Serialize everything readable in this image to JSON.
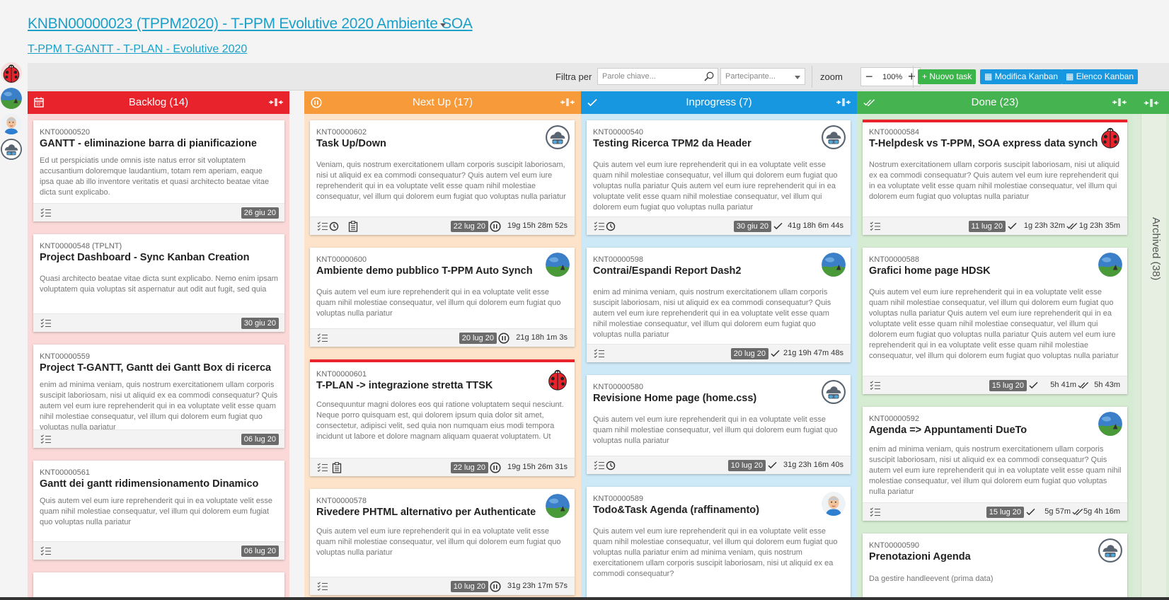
{
  "header": {
    "title": "KNBN00000023 (TPPM2020) - T-PPM Evolutive 2020 Ambiente SOA",
    "subtitle": "T-PPM T-GANTT - T-PLAN - Evolutive 2020"
  },
  "toolbar": {
    "filter_label": "Filtra per",
    "keyword_placeholder": "Parole chiave...",
    "participant_placeholder": "Partecipante...",
    "zoom_label": "zoom",
    "zoom_value": "100%",
    "new_task": "Nuovo task",
    "edit_kanban": "Modifica Kanban",
    "list_kanban": "Elenco Kanban"
  },
  "columns": {
    "backlog": {
      "label": "Backlog (14)",
      "color": "#e8232b",
      "cards": [
        {
          "code": "KNT00000520",
          "title": "GANTT - eliminazione barra di pianificazione",
          "desc": "Ed ut perspiciatis unde omnis iste natus error sit voluptatem accusantium doloremque laudantium, totam rem aperiam, eaque ipsa quae ab illo inventore veritatis et quasi architecto beatae vitae dicta sunt explicabo.",
          "date": "26 giu 20"
        },
        {
          "code": "KNT00000548 (TPLNT)",
          "title": "Project Dashboard - Sync Kanban Creation",
          "desc": "Quasi architecto beatae vitae dicta sunt explicabo. Nemo enim ipsam voluptatem quia voluptas sit aspernatur aut odit aut fugit, sed quia",
          "date": "30 giu 20"
        },
        {
          "code": "KNT00000559",
          "title": "Project T-GANTT, Gantt dei Gantt Box di ricerca",
          "desc": "enim ad minima veniam, quis nostrum exercitationem ullam corporis suscipit laboriosam, nisi ut aliquid ex ea commodi consequatur? Quis autem vel eum iure reprehenderit qui in ea voluptate velit esse quam nihil molestiae consequatur, vel illum qui dolorem eum fugiat quo voluptas nulla pariatur",
          "date": "06 lug 20"
        },
        {
          "code": "KNT00000561",
          "title": "Gantt dei gantt ridimensionamento Dinamico",
          "desc": "Quis autem vel eum iure reprehenderit qui in ea voluptate velit esse quam nihil molestiae consequatur, vel illum qui dolorem eum fugiat quo voluptas nulla pariatur",
          "date": "06 lug 20"
        }
      ]
    },
    "nextup": {
      "label": "Next Up (17)",
      "color": "#f79a3a",
      "cards": [
        {
          "code": "KNT00000602",
          "title": "Task Up/Down",
          "desc": "Veniam, quis nostrum exercitationem ullam corporis suscipit laboriosam, nisi ut aliquid ex ea commodi consequatur? Quis autem vel eum iure reprehenderit qui in ea voluptate velit esse quam nihil molestiae consequatur, vel illum qui dolorem eum fugiat quo voluptas nulla pariatur",
          "date": "22 lug 20",
          "metric1": "19g 15h 28m 52s"
        },
        {
          "code": "KNT00000600",
          "title": "Ambiente demo pubblico T-PPM Auto Synch",
          "desc": "Quis autem vel eum iure reprehenderit qui in ea voluptate velit esse quam nihil molestiae consequatur, vel illum qui dolorem eum fugiat quo voluptas nulla pariatur",
          "date": "20 lug 20",
          "metric1": "21g 18h 1m 3s"
        },
        {
          "code": "KNT00000601",
          "title": "T-PLAN -> integrazione stretta TTSK",
          "desc": "Consequuntur magni dolores eos qui ratione voluptatem sequi nesciunt. Neque porro quisquam est, qui dolorem ipsum quia dolor sit amet, consectetur, adipisci velit, sed quia non numquam eius modi tempora incidunt ut labore et dolore magnam aliquam quaerat voluptatem. Ut",
          "date": "22 lug 20",
          "metric1": "19g 15h 26m 31s"
        },
        {
          "code": "KNT00000578",
          "title": "Rivedere PHTML alternativo per Authenticate",
          "desc": "Quis autem vel eum iure reprehenderit qui in ea voluptate velit esse quam nihil molestiae consequatur, vel illum qui dolorem eum fugiat quo voluptas nulla pariatur",
          "date": "10 lug 20",
          "metric1": "31g 23h 17m 57s"
        }
      ]
    },
    "inprogress": {
      "label": "Inprogress (7)",
      "color": "#1797e0",
      "cards": [
        {
          "code": "KNT00000540",
          "title": "Testing Ricerca TPM2 da Header",
          "desc": "Quis autem vel eum iure reprehenderit qui in ea voluptate velit esse quam nihil molestiae consequatur, vel illum qui dolorem eum fugiat quo voluptas nulla pariatur Quis autem vel eum iure reprehenderit qui in ea voluptate velit esse quam nihil molestiae consequatur, vel illum qui dolorem eum fugiat quo voluptas nulla pariatur",
          "date": "30 giu 20",
          "metric1": "41g 18h 6m 44s"
        },
        {
          "code": "KNT00000598",
          "title": "Contrai/Espandi Report Dash2",
          "desc": "enim ad minima veniam, quis nostrum exercitationem ullam corporis suscipit laboriosam, nisi ut aliquid ex ea commodi consequatur? Quis autem vel eum iure reprehenderit qui in ea voluptate velit esse quam nihil molestiae consequatur, vel illum qui dolorem eum fugiat quo voluptas nulla pariatur",
          "date": "20 lug 20",
          "metric1": "21g 19h 47m 48s"
        },
        {
          "code": "KNT00000580",
          "title": "Revisione Home page (home.css)",
          "desc": "Quis autem vel eum iure reprehenderit qui in ea voluptate velit esse quam nihil molestiae consequatur, vel illum qui dolorem eum fugiat quo voluptas nulla pariatur",
          "date": "10 lug 20",
          "metric1": "31g 23h 16m 40s"
        },
        {
          "code": "KNT00000589",
          "title": "Todo&Task Agenda (raffinamento)",
          "desc": "Quis autem vel eum iure reprehenderit qui in ea voluptate velit esse quam nihil molestiae consequatur, vel illum qui dolorem eum fugiat quo voluptas nulla pariatur enim ad minima veniam, quis nostrum exercitationem ullam corporis suscipit laboriosam, nisi ut aliquid ex ea commodi consequatur?"
        }
      ]
    },
    "done": {
      "label": "Done (23)",
      "color": "#45b350",
      "cards": [
        {
          "code": "KNT00000584",
          "title": "T-Helpdesk vs T-PPM, SOA express data synch",
          "desc": "Nostrum exercitationem ullam corporis suscipit laboriosam, nisi ut aliquid ex ea commodi consequatur? Quis autem vel eum iure reprehenderit qui in ea voluptate velit esse quam nihil molestiae consequatur, vel illum qui dolorem eum fugiat quo voluptas nulla pariatur",
          "date": "11 lug 20",
          "metric1": "1g 23h 32m",
          "metric2": "1g 23h 35m"
        },
        {
          "code": "KNT00000588",
          "title": "Grafici home page HDSK",
          "desc": "Quis autem vel eum iure reprehenderit qui in ea voluptate velit esse quam nihil molestiae consequatur, vel illum qui dolorem eum fugiat quo voluptas nulla pariatur Quis autem vel eum iure reprehenderit qui in ea voluptate velit esse quam nihil molestiae consequatur, vel illum qui dolorem eum fugiat quo voluptas nulla pariatur Quis autem vel eum iure reprehenderit qui in ea voluptate velit esse quam nihil molestiae consequatur, vel illum qui dolorem eum fugiat quo voluptas nulla pariatur",
          "date": "15 lug 20",
          "metric1": "5h 41m",
          "metric2": "5h 43m"
        },
        {
          "code": "KNT00000592",
          "title": "Agenda => Appuntamenti DueTo",
          "desc": "enim ad minima veniam, quis nostrum exercitationem ullam corporis suscipit laboriosam, nisi ut aliquid ex ea commodi consequatur? Quis autem vel eum iure reprehenderit qui in ea voluptate velit esse quam nihil molestiae consequatur, vel illum qui dolorem eum fugiat quo voluptas nulla pariatur",
          "date": "15 lug 20",
          "metric1": "5g 57m",
          "metric2": "5g 4h 16m"
        },
        {
          "code": "KNT00000590",
          "title": "Prenotazioni Agenda",
          "desc": "Da gestire handleevent (prima data)"
        }
      ]
    },
    "archived": {
      "label": "Archived (38)",
      "color": "#45b350"
    }
  }
}
